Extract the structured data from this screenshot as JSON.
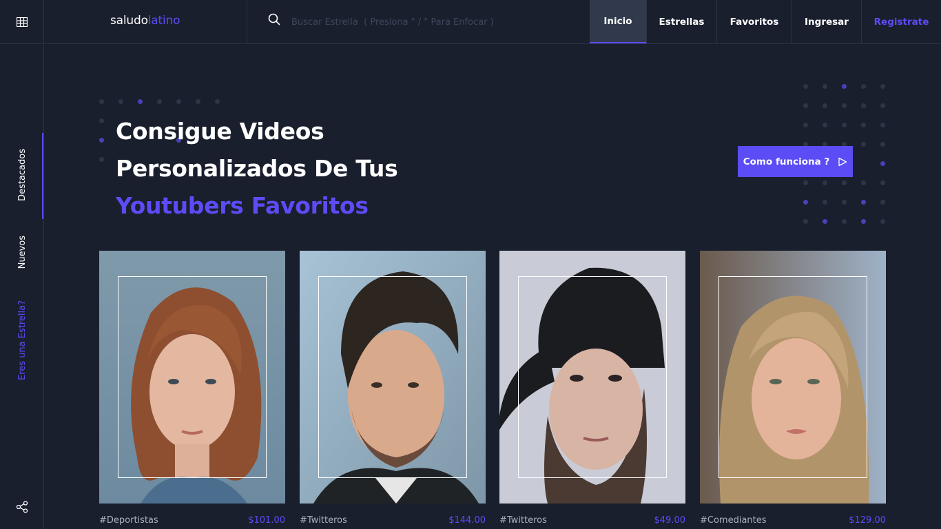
{
  "brand": {
    "name_part1": "saludo",
    "name_part2": "latino"
  },
  "search": {
    "placeholder": "Buscar Estrella  ( Presiona \" / \" Para Enfocar )"
  },
  "nav": {
    "items": [
      {
        "label": "Inicio",
        "active": true
      },
      {
        "label": "Estrellas"
      },
      {
        "label": "Favoritos"
      },
      {
        "label": "Ingresar"
      },
      {
        "label": "Registrate",
        "accent": true
      }
    ]
  },
  "sidebar": {
    "items": [
      {
        "label": "Destacados",
        "active": true
      },
      {
        "label": "Nuevos"
      },
      {
        "label": "Eres una Estrella?",
        "accent": true
      }
    ]
  },
  "hero": {
    "line1": "Consigue Videos",
    "line2": "Personalizados De Tus",
    "line3": "Youtubers Favoritos",
    "cta_label": "Como funciona ?"
  },
  "cards": [
    {
      "tag": "#Deportistas",
      "price": "$101.00"
    },
    {
      "tag": "#Twitteros",
      "price": "$144.00"
    },
    {
      "tag": "#Twitteros",
      "price": "$49.00"
    },
    {
      "tag": "#Comediantes",
      "price": "$129.00"
    }
  ],
  "colors": {
    "background": "#1a1f2e",
    "accent": "#5b4cf5",
    "active_tab": "#313a4c",
    "border": "#2c3344",
    "muted_text": "#a9b0c0"
  },
  "icons": [
    "grid-icon",
    "search-icon",
    "play-icon",
    "share-icon"
  ]
}
